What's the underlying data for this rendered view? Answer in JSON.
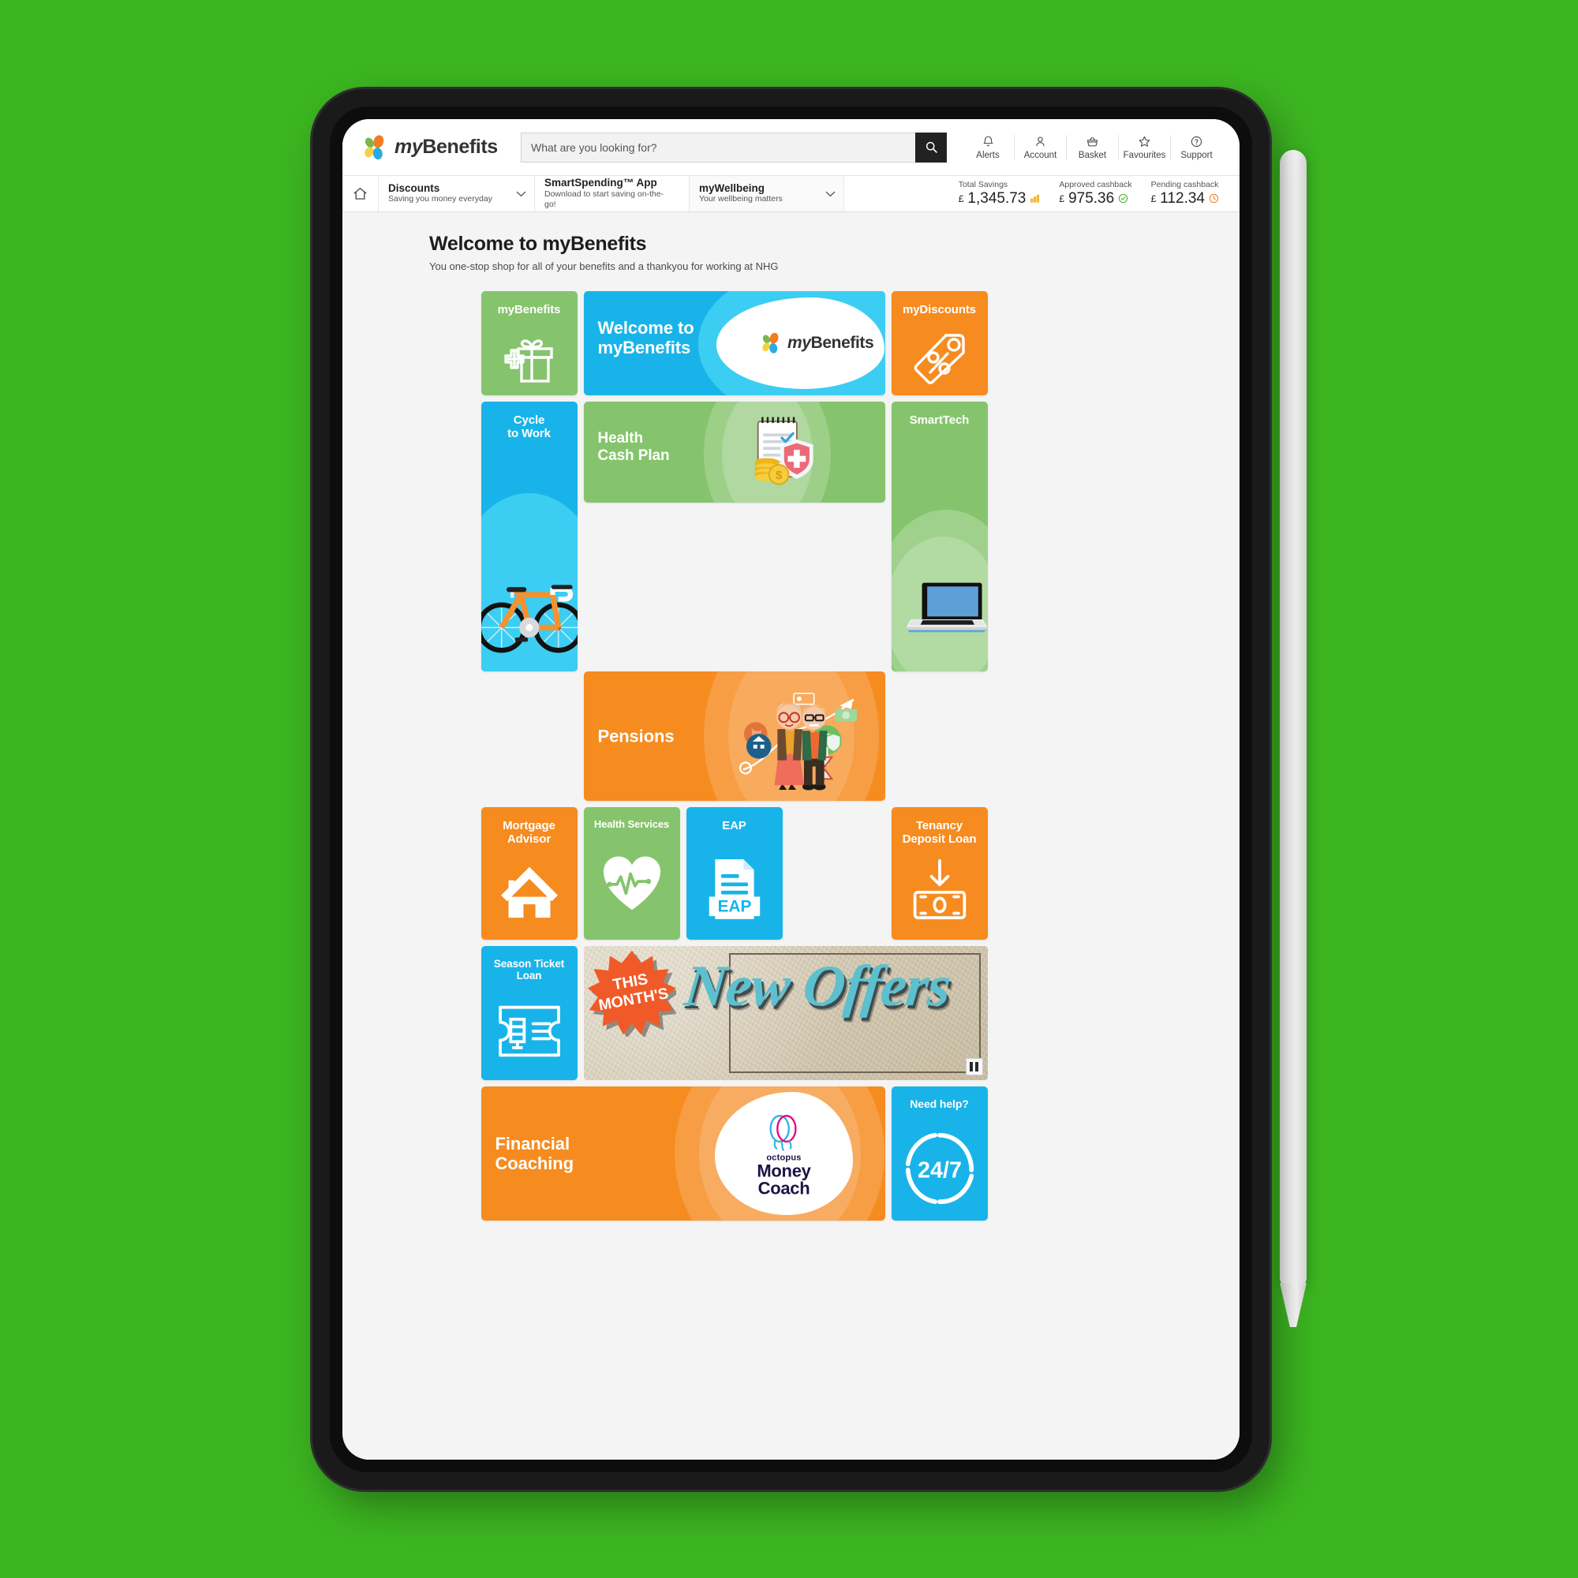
{
  "brand": {
    "name_prefix": "my",
    "name_suffix": "Benefits",
    "logo_icon": "myb-petal-logo-icon"
  },
  "search": {
    "placeholder": "What are you looking for?",
    "value": "",
    "button_icon": "search-icon"
  },
  "header_nav": [
    {
      "label": "Alerts",
      "icon": "bell-icon"
    },
    {
      "label": "Account",
      "icon": "user-icon"
    },
    {
      "label": "Basket",
      "icon": "basket-icon"
    },
    {
      "label": "Favourites",
      "icon": "star-icon"
    },
    {
      "label": "Support",
      "icon": "question-circle-icon"
    }
  ],
  "subnav": {
    "home_icon": "home-icon",
    "items": [
      {
        "title": "Discounts",
        "subtitle": "Saving you money everyday",
        "caret": "chevron-down-icon"
      },
      {
        "title": "SmartSpending™ App",
        "subtitle": "Download to start saving on-the-go!",
        "caret": ""
      },
      {
        "title": "myWellbeing",
        "subtitle": "Your wellbeing matters",
        "caret": "chevron-down-icon"
      }
    ],
    "savings": [
      {
        "label": "Total Savings",
        "currency": "£",
        "amount": "1,345.73",
        "icon": "coins-icon",
        "color": "#f5b731"
      },
      {
        "label": "Approved cashback",
        "currency": "£",
        "amount": "975.36",
        "icon": "check-circle-icon",
        "color": "#43b02a"
      },
      {
        "label": "Pending cashback",
        "currency": "£",
        "amount": "112.34",
        "icon": "clock-icon",
        "color": "#f47b20"
      }
    ]
  },
  "page": {
    "title": "Welcome to myBenefits",
    "subtitle": "You one-stop shop for all of your benefits and a thankyou for working at NHG"
  },
  "tiles": {
    "my_benefits": {
      "label": "myBenefits",
      "color": "#85c46c",
      "icon": "gift-plus-icon"
    },
    "welcome_hero": {
      "label_line1": "Welcome to",
      "label_line2": "myBenefits",
      "color": "#18b4e9",
      "icon": "myb-petal-logo-icon"
    },
    "my_discounts": {
      "label": "myDiscounts",
      "color": "#f68b1f",
      "icon": "percent-tag-icon"
    },
    "cycle_to_work": {
      "label_line1": "Cycle",
      "label_line2": "to Work",
      "color": "#18b4e9",
      "icon": "bicycle-icon"
    },
    "health_cash_plan": {
      "label_line1": "Health",
      "label_line2": "Cash Plan",
      "color": "#85c46c",
      "icon": "clipboard-shield-coins-icon"
    },
    "smart_tech": {
      "label": "SmartTech",
      "color": "#85c46c",
      "icon": "laptop-icon"
    },
    "pensions": {
      "label": "Pensions",
      "color": "#f68b1f",
      "icon": "elderly-couple-icon"
    },
    "mortgage_advisor": {
      "label_line1": "Mortgage",
      "label_line2": "Advisor",
      "color": "#f68b1f",
      "icon": "house-icon"
    },
    "health_services": {
      "label": "Health Services",
      "color": "#85c46c",
      "icon": "heart-pulse-icon"
    },
    "eap": {
      "label": "EAP",
      "badge": "EAP",
      "color": "#18b4e9",
      "icon": "document-eap-icon"
    },
    "tenancy_deposit_loan": {
      "label_line1": "Tenancy",
      "label_line2": "Deposit Loan",
      "color": "#f68b1f",
      "icon": "arrow-down-banknote-icon"
    },
    "season_ticket_loan": {
      "label_line1": "Season Ticket",
      "label_line2": "Loan",
      "color": "#18b4e9",
      "icon": "ticket-icon"
    },
    "new_offers_banner": {
      "burst_line1": "THIS",
      "burst_line2": "MONTH'S",
      "headline": "New Offers",
      "pause_icon": "pause-icon"
    },
    "financial_coaching": {
      "label_line1": "Financial",
      "label_line2": "Coaching",
      "color": "#f68b1f",
      "logo_small": "octopus",
      "logo_line1": "Money",
      "logo_line2": "Coach"
    },
    "need_help": {
      "label": "Need help?",
      "color": "#18b4e9",
      "badge": "24/7",
      "icon": "twentyfour-seven-icon"
    }
  }
}
